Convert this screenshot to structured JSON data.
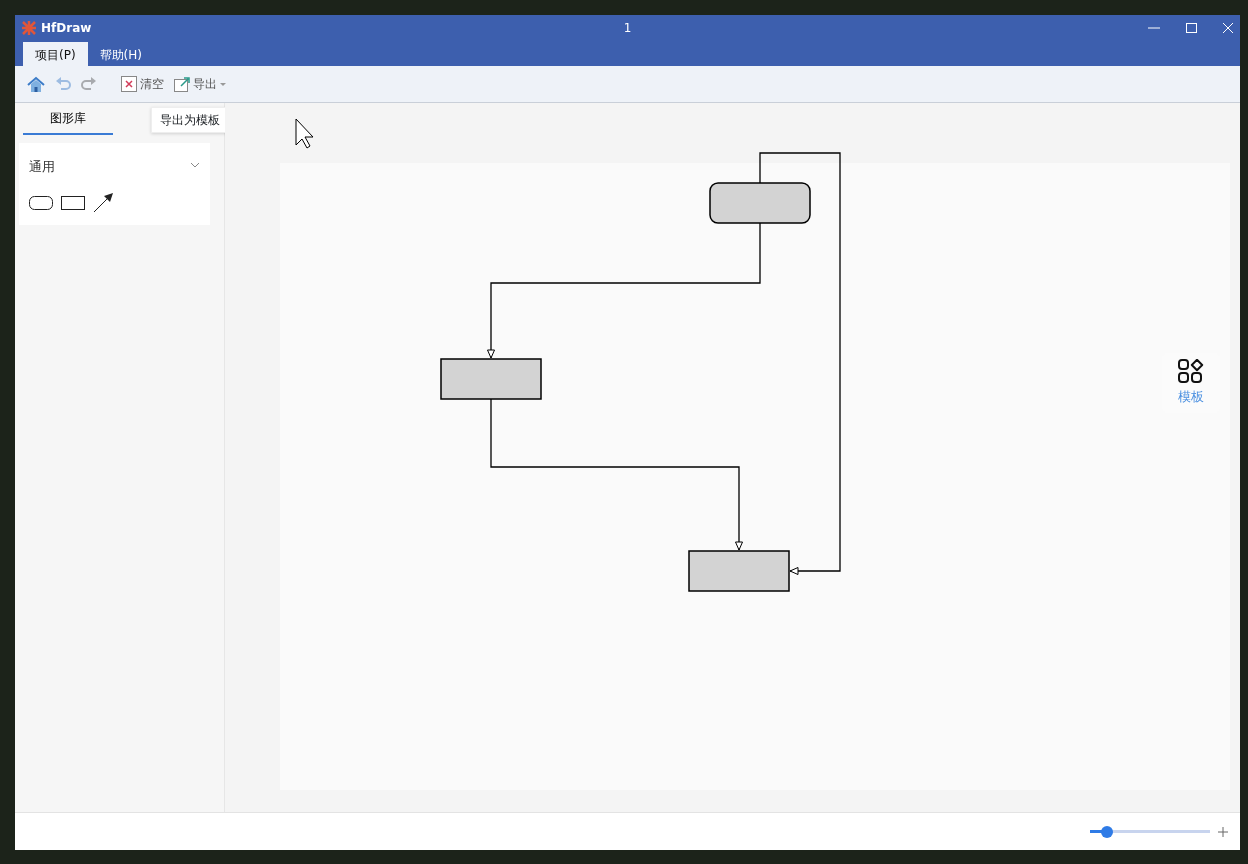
{
  "window": {
    "app_name": "HfDraw",
    "title": "1"
  },
  "menu_tabs": [
    {
      "label": "项目(P)",
      "selected": true
    },
    {
      "label": "帮助(H)",
      "selected": false
    }
  ],
  "toolbar": [
    {
      "kind": "home",
      "disabled": false
    },
    {
      "kind": "undo",
      "disabled": true
    },
    {
      "kind": "redo",
      "disabled": true
    },
    {
      "kind": "clear",
      "label": "清空",
      "disabled": false
    },
    {
      "kind": "export",
      "label": "导出",
      "disabled": false
    }
  ],
  "sidebar": {
    "tabs": [
      {
        "label": "图形库",
        "selected": true
      }
    ],
    "tooltip": "导出为模板",
    "group": {
      "label": "通用",
      "expanded": true,
      "shapes": [
        {
          "kind": "rounded"
        },
        {
          "kind": "rect"
        },
        {
          "kind": "arrow"
        }
      ]
    }
  },
  "diagram": {
    "nodes": [
      {
        "kind": "rounded"
      },
      {
        "kind": "rect"
      },
      {
        "kind": "rect"
      }
    ]
  },
  "templates_button": {
    "label": "模板"
  },
  "status_bar": {
    "zoom": {
      "level": 0.1
    }
  }
}
